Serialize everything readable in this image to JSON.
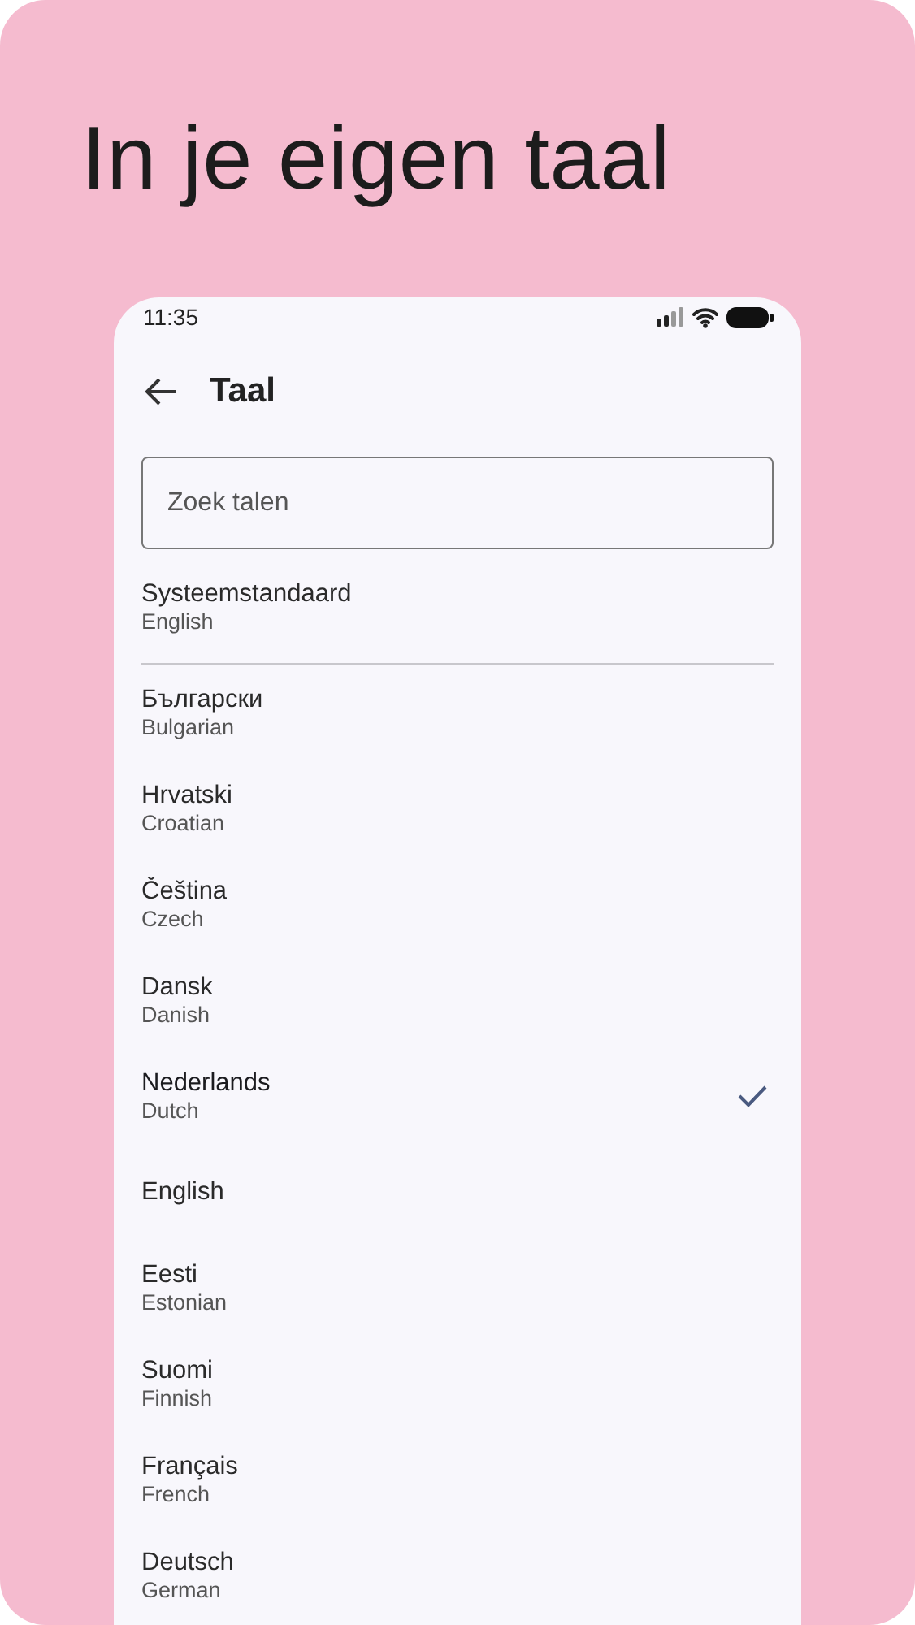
{
  "headline": "In je eigen taal",
  "status_bar": {
    "time": "11:35"
  },
  "app_bar": {
    "title": "Taal"
  },
  "search": {
    "placeholder": "Zoek talen"
  },
  "system_default": {
    "name": "Systeemstandaard",
    "subtitle": "English"
  },
  "languages": [
    {
      "name": "Български",
      "subtitle": "Bulgarian",
      "selected": false
    },
    {
      "name": "Hrvatski",
      "subtitle": "Croatian",
      "selected": false
    },
    {
      "name": "Čeština",
      "subtitle": "Czech",
      "selected": false
    },
    {
      "name": "Dansk",
      "subtitle": "Danish",
      "selected": false
    },
    {
      "name": "Nederlands",
      "subtitle": "Dutch",
      "selected": true
    },
    {
      "name": "English",
      "selected": false
    },
    {
      "name": "Eesti",
      "subtitle": "Estonian",
      "selected": false
    },
    {
      "name": "Suomi",
      "subtitle": "Finnish",
      "selected": false
    },
    {
      "name": "Français",
      "subtitle": "French",
      "selected": false
    },
    {
      "name": "Deutsch",
      "subtitle": "German",
      "selected": false
    }
  ]
}
